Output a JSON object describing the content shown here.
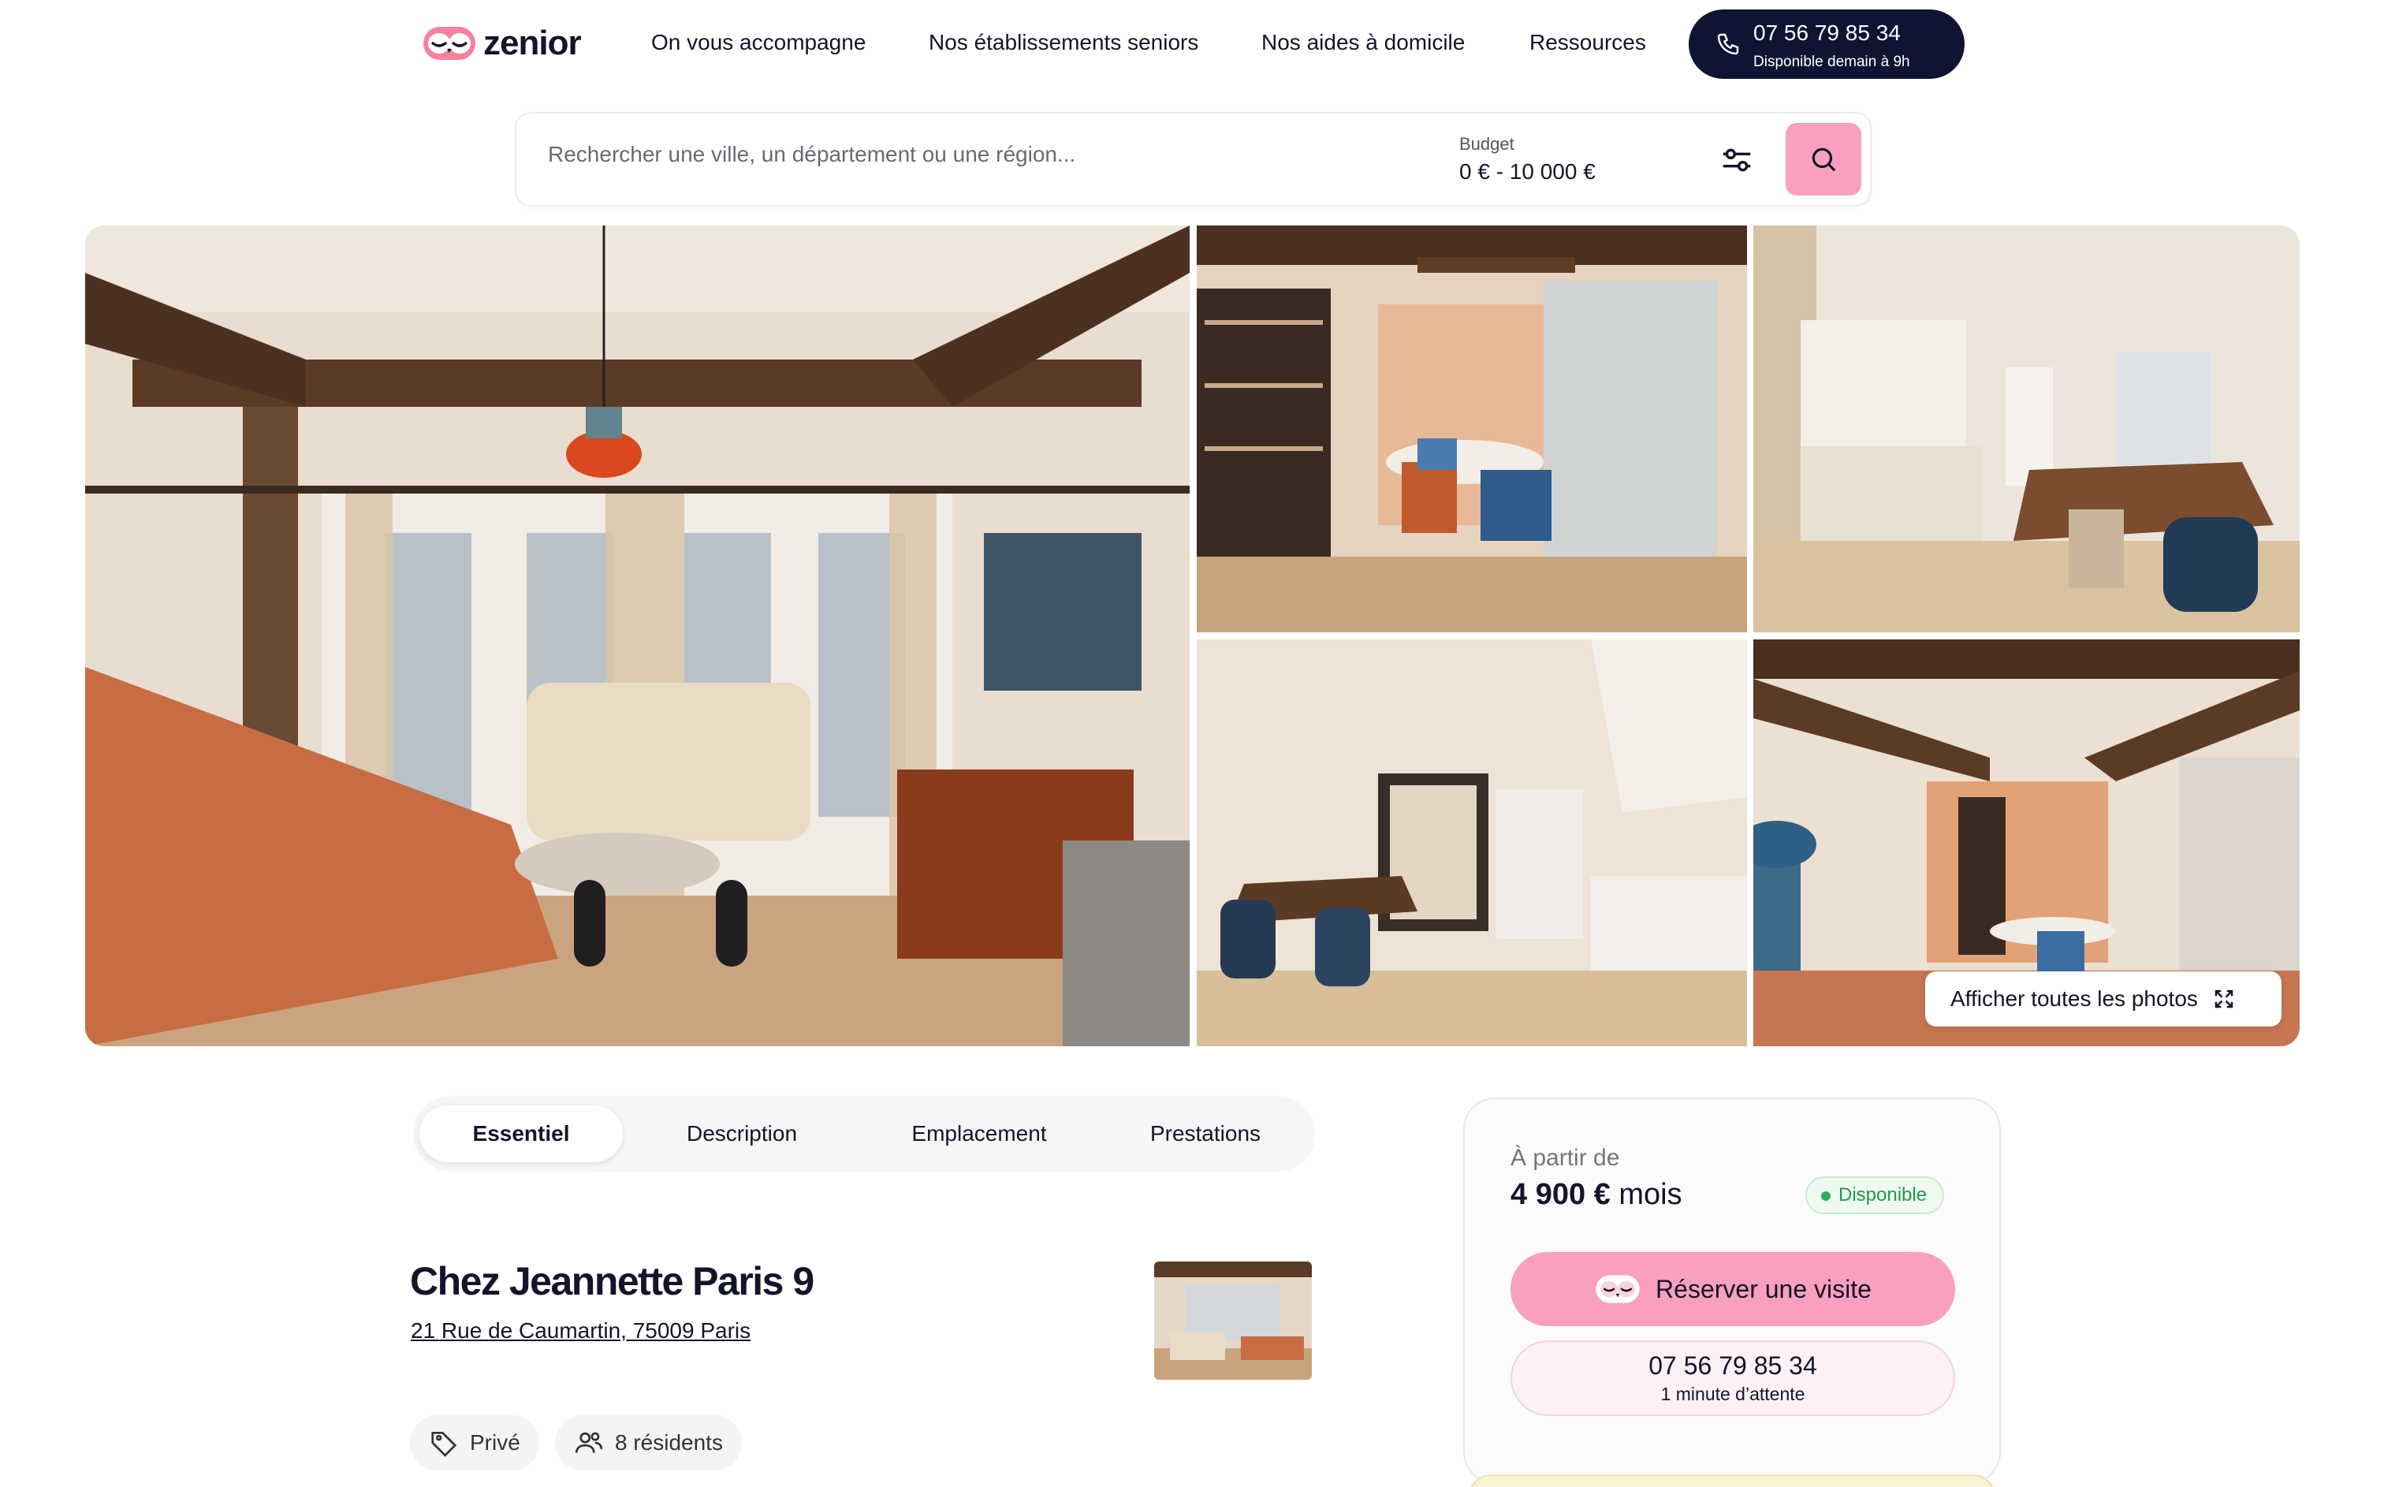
{
  "brand": {
    "name": "zenior",
    "accent_pink": "#f9a0be",
    "navy": "#0f1433"
  },
  "nav": {
    "items": [
      "On vous accompagne",
      "Nos établissements seniors",
      "Nos aides à domicile",
      "Ressources"
    ],
    "phone_number": "07 56 79 85 34",
    "phone_note": "Disponible demain à 9h"
  },
  "search": {
    "placeholder": "Rechercher une ville, un département ou une région...",
    "budget_label": "Budget",
    "budget_value": "0 € - 10 000 €",
    "filter_icon": "sliders-icon",
    "search_icon": "search-icon"
  },
  "gallery": {
    "show_all_label": "Afficher toutes les photos",
    "expand_icon": "expand-icon"
  },
  "tabs": [
    "Essentiel",
    "Description",
    "Emplacement",
    "Prestations"
  ],
  "listing": {
    "title": "Chez Jeannette Paris 9",
    "address": "21 Rue de Caumartin, 75009 Paris",
    "chips": {
      "type": "Privé",
      "residents": "8 résidents"
    }
  },
  "booking": {
    "from_label": "À partir de",
    "price": "4 900 €",
    "period": "mois",
    "status": "Disponible",
    "book_label": "Réserver une visite",
    "phone_number": "07 56 79 85 34",
    "wait_note": "1 minute d’attente"
  }
}
